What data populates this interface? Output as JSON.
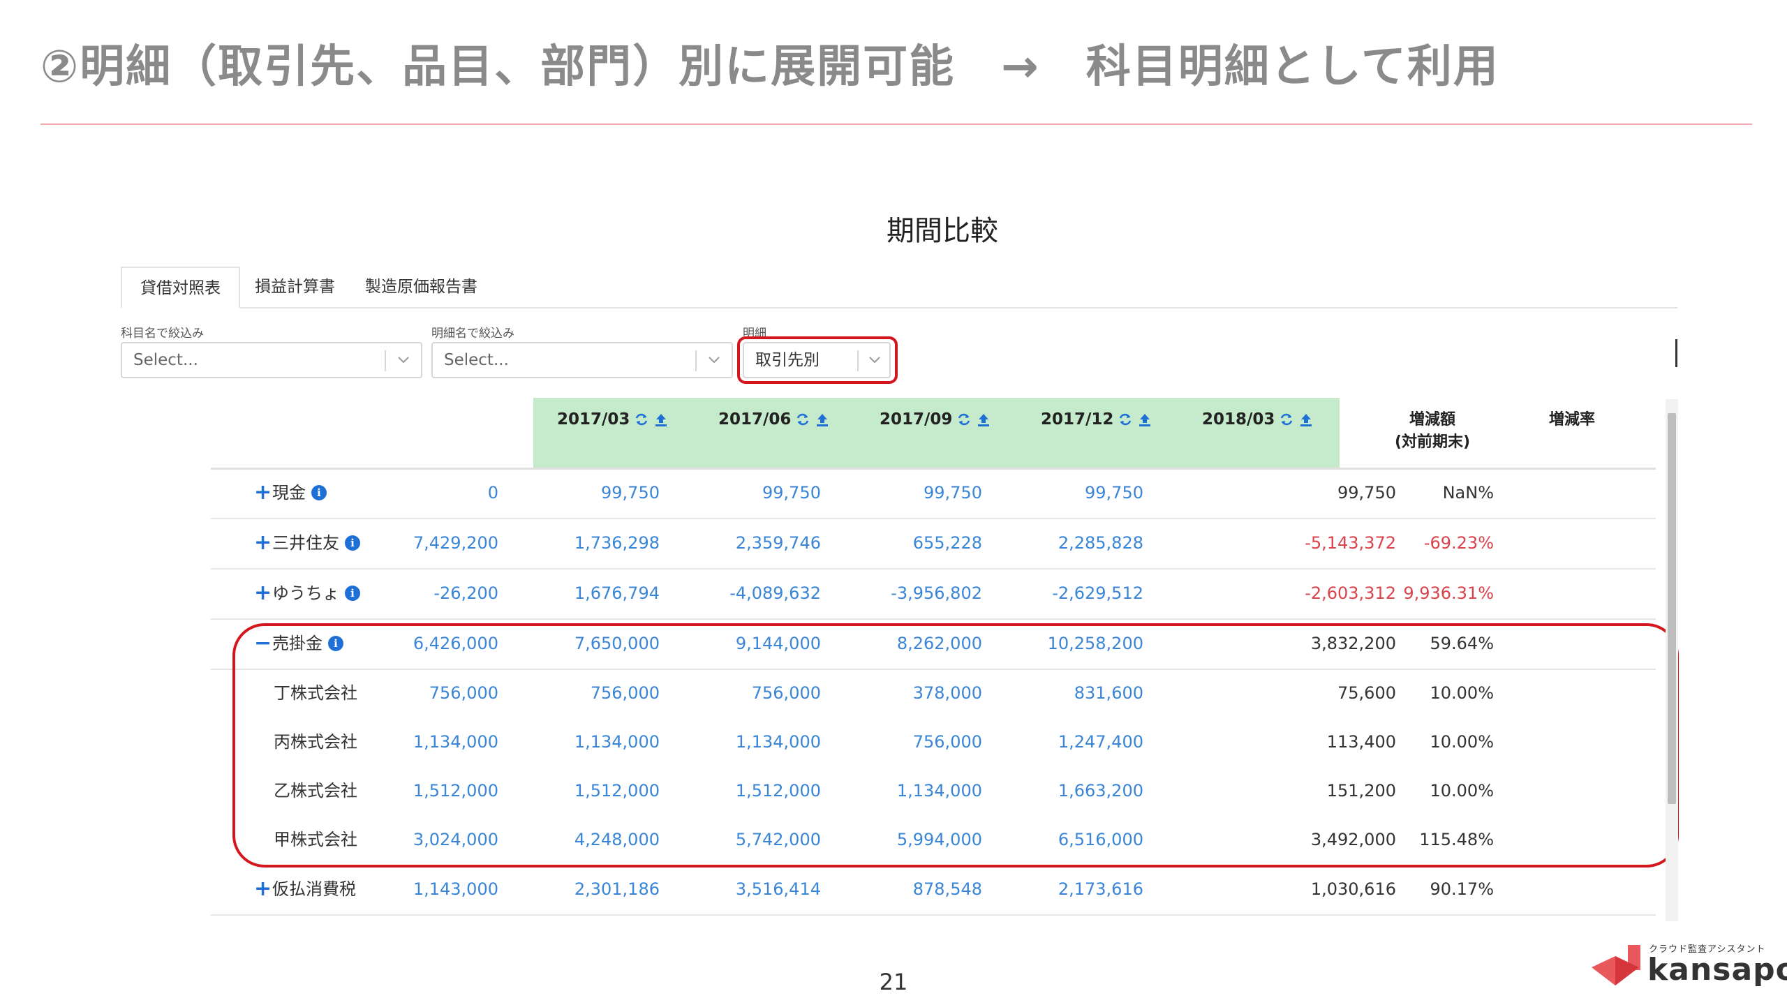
{
  "slide": {
    "title": "②明細（取引先、品目、部門）別に展開可能　→　科目明細として利用",
    "page_number": "21"
  },
  "panel": {
    "heading": "期間比較"
  },
  "tabs": [
    {
      "label": "貸借対照表",
      "active": true
    },
    {
      "label": "損益計算書",
      "active": false
    },
    {
      "label": "製造原価報告書",
      "active": false
    }
  ],
  "filters": {
    "account": {
      "label": "科目名で絞込み",
      "value": "Select..."
    },
    "detail_name": {
      "label": "明細名で絞込み",
      "value": "Select..."
    },
    "detail": {
      "label": "明細",
      "value": "取引先別"
    }
  },
  "table": {
    "periods": [
      "2017/03",
      "2017/06",
      "2017/09",
      "2017/12",
      "2018/03"
    ],
    "diff_header": [
      "増減額",
      "(対前期末)"
    ],
    "rate_header": "増減率",
    "rows": [
      {
        "toggle": "+",
        "name": "現金",
        "info": true,
        "values": [
          "0",
          "99,750",
          "99,750",
          "99,750",
          "99,750"
        ],
        "diff": "99,750",
        "rate": "NaN%",
        "neg": false
      },
      {
        "toggle": "+",
        "name": "三井住友",
        "info": true,
        "values": [
          "7,429,200",
          "1,736,298",
          "2,359,746",
          "655,228",
          "2,285,828"
        ],
        "diff": "-5,143,372",
        "rate": "-69.23%",
        "neg": true
      },
      {
        "toggle": "+",
        "name": "ゆうちょ",
        "info": true,
        "values": [
          "-26,200",
          "1,676,794",
          "-4,089,632",
          "-3,956,802",
          "-2,629,512"
        ],
        "diff": "-2,603,312",
        "rate": "9,936.31%",
        "neg": true
      },
      {
        "toggle": "−",
        "name": "売掛金",
        "info": true,
        "values": [
          "6,426,000",
          "7,650,000",
          "9,144,000",
          "8,262,000",
          "10,258,200"
        ],
        "diff": "3,832,200",
        "rate": "59.64%",
        "neg": false
      },
      {
        "toggle": "",
        "name": "丁株式会社",
        "info": false,
        "values": [
          "756,000",
          "756,000",
          "756,000",
          "378,000",
          "831,600"
        ],
        "diff": "75,600",
        "rate": "10.00%",
        "neg": false
      },
      {
        "toggle": "",
        "name": "丙株式会社",
        "info": false,
        "values": [
          "1,134,000",
          "1,134,000",
          "1,134,000",
          "756,000",
          "1,247,400"
        ],
        "diff": "113,400",
        "rate": "10.00%",
        "neg": false
      },
      {
        "toggle": "",
        "name": "乙株式会社",
        "info": false,
        "values": [
          "1,512,000",
          "1,512,000",
          "1,512,000",
          "1,134,000",
          "1,663,200"
        ],
        "diff": "151,200",
        "rate": "10.00%",
        "neg": false
      },
      {
        "toggle": "",
        "name": "甲株式会社",
        "info": false,
        "values": [
          "3,024,000",
          "4,248,000",
          "5,742,000",
          "5,994,000",
          "6,516,000"
        ],
        "diff": "3,492,000",
        "rate": "115.48%",
        "neg": false
      },
      {
        "toggle": "+",
        "name": "仮払消費税",
        "info": false,
        "values": [
          "1,143,000",
          "2,301,186",
          "3,516,414",
          "878,548",
          "2,173,616"
        ],
        "diff": "1,030,616",
        "rate": "90.17%",
        "neg": false
      }
    ]
  },
  "logo": {
    "tagline": "クラウド監査アシスタント",
    "name": "kansapo"
  },
  "colors": {
    "accent_blue": "#3a85d6",
    "negative_red": "#d9434c",
    "period_header_bg": "#c6ebcc",
    "highlight_red": "#d4161d"
  }
}
